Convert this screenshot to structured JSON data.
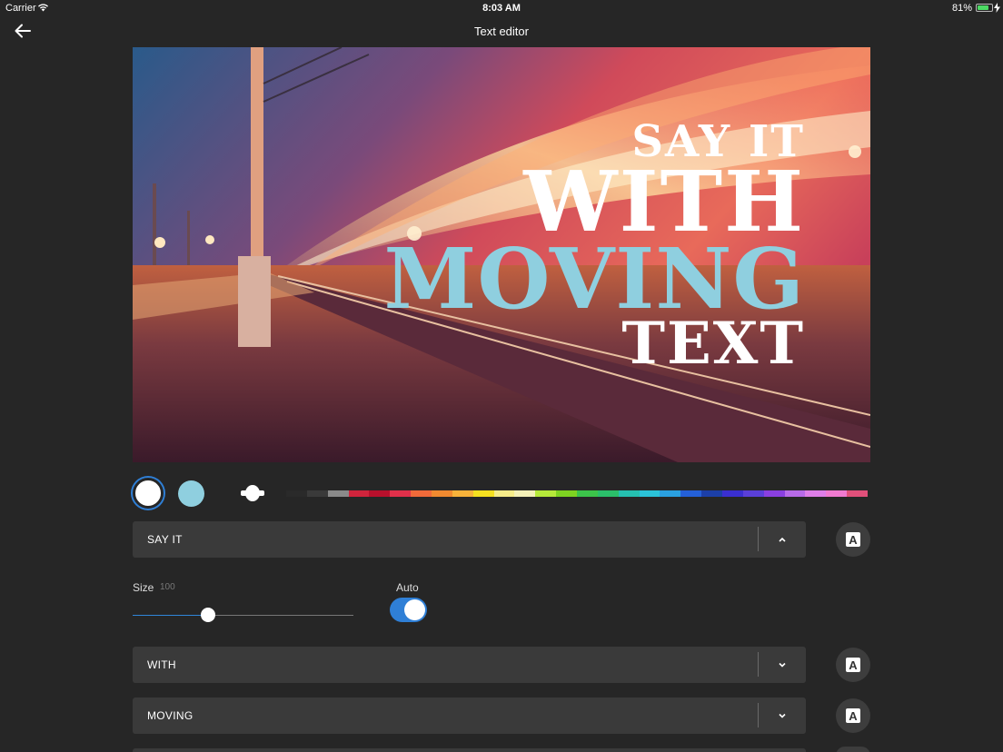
{
  "status": {
    "carrier": "Carrier",
    "time": "8:03 AM",
    "battery": "81%",
    "battery_level": 0.81
  },
  "nav": {
    "title": "Text editor"
  },
  "preview": {
    "lines": [
      {
        "text": "SAY IT",
        "color": "#ffffff"
      },
      {
        "text": "WITH",
        "color": "#ffffff"
      },
      {
        "text": "MOVING",
        "color": "#8fcfdf"
      },
      {
        "text": "TEXT",
        "color": "#ffffff"
      }
    ]
  },
  "colors": {
    "swatches": [
      "#ffffff",
      "#8fcfdf"
    ],
    "accent": "#2f7fd6",
    "palette": [
      "#2a2a2a",
      "#3a3a3a",
      "#8a8a8a",
      "#d0243c",
      "#b8102c",
      "#e0304a",
      "#f06a3a",
      "#f08a30",
      "#f7b23a",
      "#f5e020",
      "#f6ec8a",
      "#f4f0b8",
      "#b6e93a",
      "#7ed321",
      "#3cc44a",
      "#2bbf6a",
      "#25c0b0",
      "#2bc3d8",
      "#2aa0e0",
      "#2460d8",
      "#1c3fa8",
      "#3a2fd0",
      "#5a3fd8",
      "#8a3fe0",
      "#b76ae8",
      "#de7ee8",
      "#f07ad0",
      "#e0507a"
    ]
  },
  "layers": [
    {
      "label": "SAY IT",
      "expanded": true
    },
    {
      "label": "WITH",
      "expanded": false
    },
    {
      "label": "MOVING",
      "expanded": false
    }
  ],
  "size_control": {
    "label": "Size",
    "value": "100",
    "level": 0.34
  },
  "auto_control": {
    "label": "Auto",
    "on": true
  },
  "font_button": {
    "glyph": "A"
  }
}
